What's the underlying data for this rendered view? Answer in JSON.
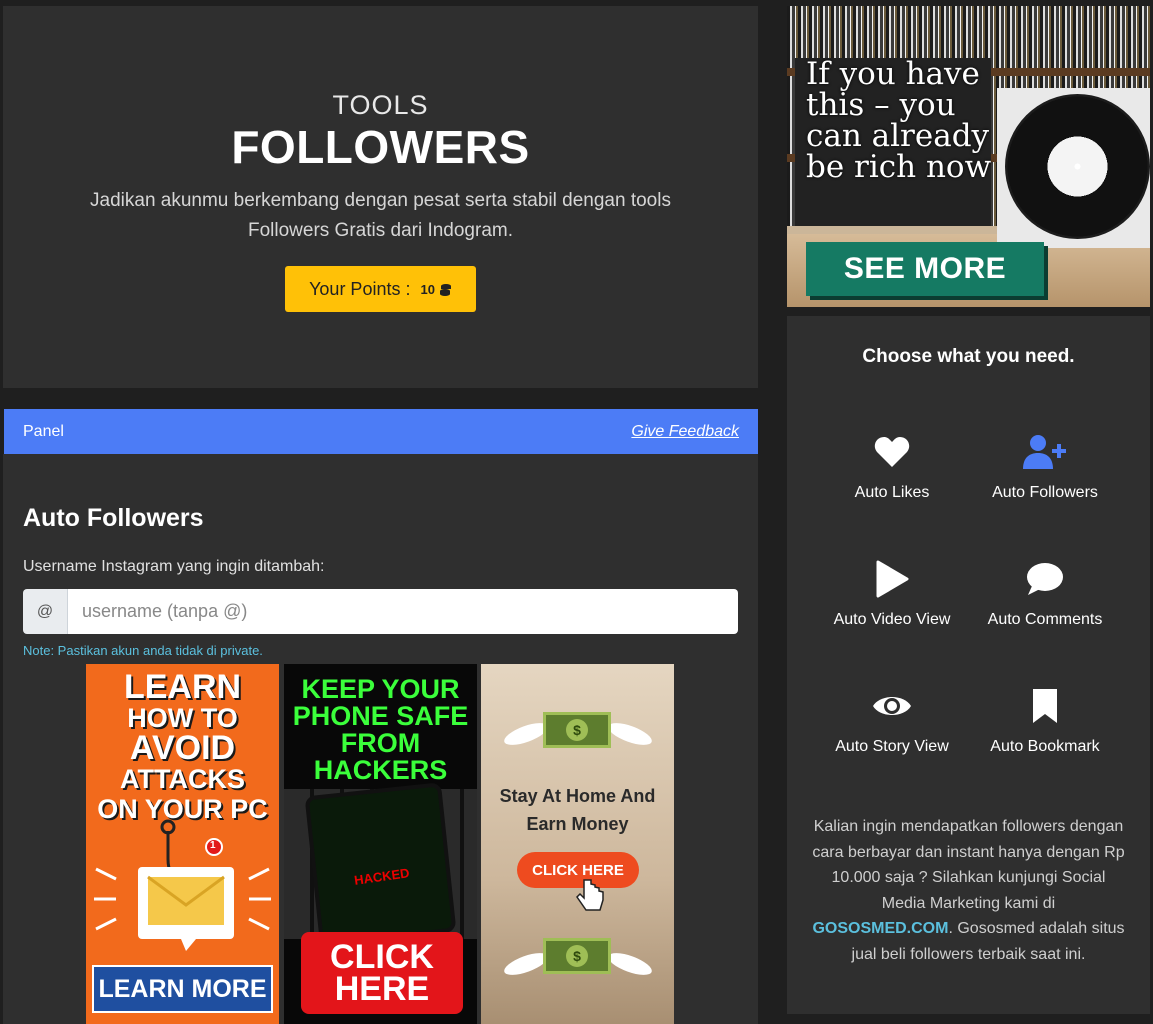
{
  "hero": {
    "eyebrow": "TOOLS",
    "title": "FOLLOWERS",
    "description": "Jadikan akunmu berkembang dengan pesat serta stabil dengan tools Followers Gratis dari Indogram.",
    "points_label": "Your Points :",
    "points_value": "10"
  },
  "panel": {
    "header_label": "Panel",
    "feedback_link": "Give Feedback",
    "form_title": "Auto Followers",
    "field_label": "Username Instagram yang ingin ditambah:",
    "input_prefix": "@",
    "input_placeholder": "username (tanpa @)",
    "input_value": "",
    "note": "Note: Pastikan akun anda tidak di private."
  },
  "ads": {
    "ad1": {
      "line1": "LEARN",
      "line2": "HOW TO",
      "line3": "AVOID",
      "line4": "ATTACKS",
      "line5": "ON YOUR PC",
      "badge": "1",
      "cta": "LEARN MORE"
    },
    "ad2": {
      "line1": "KEEP YOUR",
      "line2": "PHONE SAFE",
      "line3": "FROM",
      "line4": "HACKERS",
      "screen_text": "HACKED",
      "cta_line1": "CLICK",
      "cta_line2": "HERE"
    },
    "ad3": {
      "line1": "Stay At Home And",
      "line2": "Earn Money",
      "cta": "CLICK HERE",
      "symbol": "$"
    },
    "ad4": {
      "line1": "If you have",
      "line2": "this – you",
      "line3": "can already",
      "line4": "be rich now",
      "cta": "SEE MORE"
    }
  },
  "sidebar": {
    "heading": "Choose what you need.",
    "tools": [
      {
        "label": "Auto Likes",
        "icon": "heart-icon",
        "color": "#ffffff"
      },
      {
        "label": "Auto Followers",
        "icon": "user-plus-icon",
        "color": "#4c7cf6"
      },
      {
        "label": "Auto Video View",
        "icon": "play-icon",
        "color": "#ffffff"
      },
      {
        "label": "Auto Comments",
        "icon": "comment-icon",
        "color": "#ffffff"
      },
      {
        "label": "Auto Story View",
        "icon": "eye-icon",
        "color": "#ffffff"
      },
      {
        "label": "Auto Bookmark",
        "icon": "bookmark-icon",
        "color": "#ffffff"
      }
    ],
    "info_before": "Kalian ingin mendapatkan followers dengan cara berbayar dan instant hanya dengan Rp 10.000 saja ? Silahkan kunjungi Social Media Marketing kami di ",
    "info_link": "GOSOSMED.COM",
    "info_after": ". Gososmed adalah situs jual beli followers terbaik saat ini."
  },
  "colors": {
    "accent": "#4c7cf6",
    "points_button": "#ffc107",
    "note": "#5bc0de",
    "panel_bg": "#2f2f2f"
  }
}
